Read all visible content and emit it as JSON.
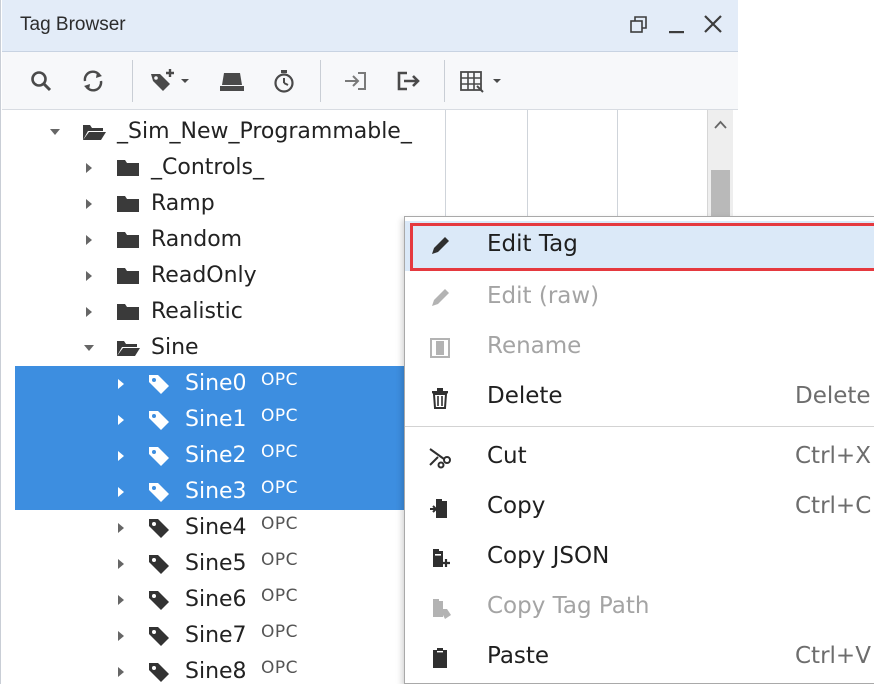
{
  "panel": {
    "title": "Tag Browser",
    "window_controls": [
      "restore-icon",
      "minimize-icon",
      "close-icon"
    ]
  },
  "toolbar": {
    "buttons": [
      "search-icon",
      "refresh-icon",
      "add-tag-icon",
      "device-icon",
      "timer-icon",
      "import-icon",
      "export-icon",
      "table-view-icon"
    ]
  },
  "tree": {
    "root": "_Sim_New_Programmable_",
    "folders": [
      "_Controls_",
      "Ramp",
      "Random",
      "ReadOnly",
      "Realistic",
      "Sine"
    ],
    "tags": [
      {
        "name": "Sine0",
        "type": "OPC",
        "selected": true
      },
      {
        "name": "Sine1",
        "type": "OPC",
        "selected": true
      },
      {
        "name": "Sine2",
        "type": "OPC",
        "selected": true
      },
      {
        "name": "Sine3",
        "type": "OPC",
        "selected": true
      },
      {
        "name": "Sine4",
        "type": "OPC",
        "selected": false
      },
      {
        "name": "Sine5",
        "type": "OPC",
        "selected": false
      },
      {
        "name": "Sine6",
        "type": "OPC",
        "selected": false
      },
      {
        "name": "Sine7",
        "type": "OPC",
        "selected": false
      },
      {
        "name": "Sine8",
        "type": "OPC",
        "selected": false
      }
    ]
  },
  "context_menu": {
    "items": [
      {
        "label": "Edit Tag",
        "shortcut": "",
        "icon": "pencil-icon",
        "enabled": true,
        "highlighted": true
      },
      {
        "label": "Edit (raw)",
        "shortcut": "",
        "icon": "pencil-icon",
        "enabled": false
      },
      {
        "label": "Rename",
        "shortcut": "",
        "icon": "rename-icon",
        "enabled": false
      },
      {
        "label": "Delete",
        "shortcut": "Delete",
        "icon": "trash-icon",
        "enabled": true
      },
      {
        "label": "Cut",
        "shortcut": "Ctrl+X",
        "icon": "scissors-icon",
        "enabled": true
      },
      {
        "label": "Copy",
        "shortcut": "Ctrl+C",
        "icon": "copy-icon",
        "enabled": true
      },
      {
        "label": "Copy JSON",
        "shortcut": "",
        "icon": "copy-json-icon",
        "enabled": true
      },
      {
        "label": "Copy Tag Path",
        "shortcut": "",
        "icon": "copy-path-icon",
        "enabled": false
      },
      {
        "label": "Paste",
        "shortcut": "Ctrl+V",
        "icon": "paste-icon",
        "enabled": true
      }
    ]
  },
  "colors": {
    "selection": "#3d8ee0",
    "menu_highlight": "#dbe9f8",
    "highlight_border": "#e5393f",
    "titlebar": "#e3ecf8"
  }
}
